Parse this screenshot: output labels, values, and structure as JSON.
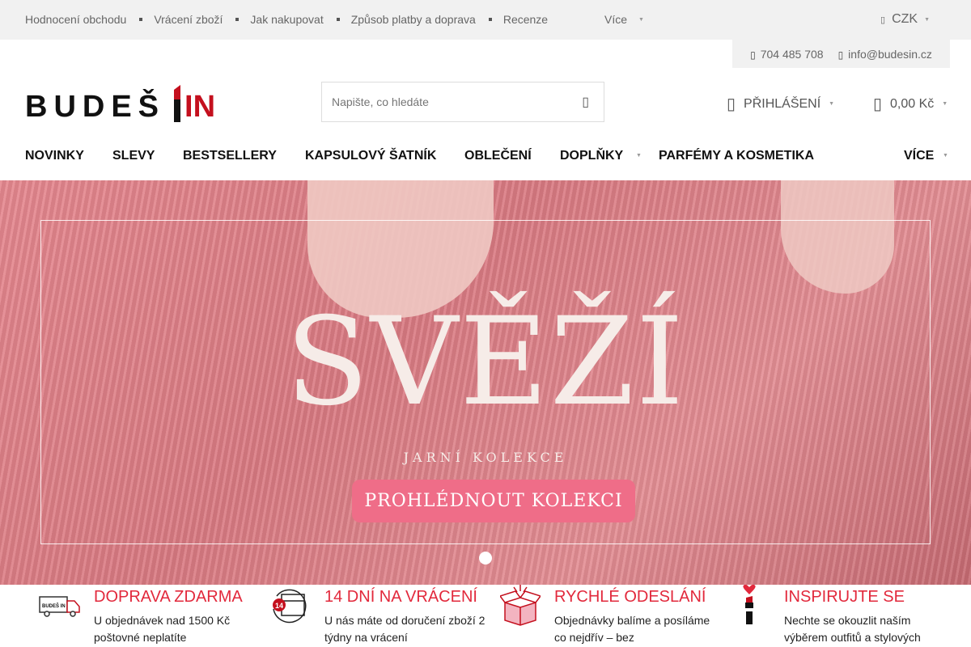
{
  "topbar": {
    "links": [
      "Hodnocení obchodu",
      "Vrácení zboží",
      "Jak nakupovat",
      "Způsob platby a doprava",
      "Recenze"
    ],
    "more_label": "Více",
    "currency": "CZK"
  },
  "contact": {
    "phone": "704 485 708",
    "email": "info@budesin.cz"
  },
  "logo": {
    "text_main": "BUDEŠ",
    "text_end": "IN"
  },
  "search": {
    "placeholder": "Napište, co hledáte"
  },
  "header": {
    "login_label": "PŘIHLÁŠENÍ",
    "cart_total": "0,00 Kč"
  },
  "nav": {
    "items": [
      "NOVINKY",
      "SLEVY",
      "BESTSELLERY",
      "KAPSULOVÝ ŠATNÍK",
      "OBLEČENÍ",
      "DOPLŇKY",
      "PARFÉMY A KOSMETIKA"
    ],
    "more_label": "VÍCE"
  },
  "hero": {
    "title": "SVĚŽÍ",
    "subtitle": "JARNÍ KOLEKCE",
    "cta_label": "PROHLÉDNOUT KOLEKCI",
    "slide_count": 1,
    "active_slide": 1
  },
  "benefits": [
    {
      "icon": "delivery-truck-icon",
      "title": "DOPRAVA ZDARMA",
      "text": "U objednávek nad 1500 Kč poštovné neplatíte"
    },
    {
      "icon": "return-14-days-icon",
      "title": "14 DNÍ NA VRÁCENÍ",
      "text": "U nás máte od doručení zboží 2 týdny na vrácení"
    },
    {
      "icon": "gift-box-icon",
      "title": "RYCHLÉ ODESLÁNÍ",
      "text": "Objednávky balíme a posíláme co nejdřív – bez"
    },
    {
      "icon": "lipstick-heart-icon",
      "title": "INSPIRUJTE SE",
      "text": "Nechte se okouzlit naším výběrem outfitů a stylových"
    }
  ],
  "colors": {
    "accent_red": "#e2293c",
    "cta_pink": "#ef6d88",
    "topbar_bg": "#f1f1f1"
  }
}
